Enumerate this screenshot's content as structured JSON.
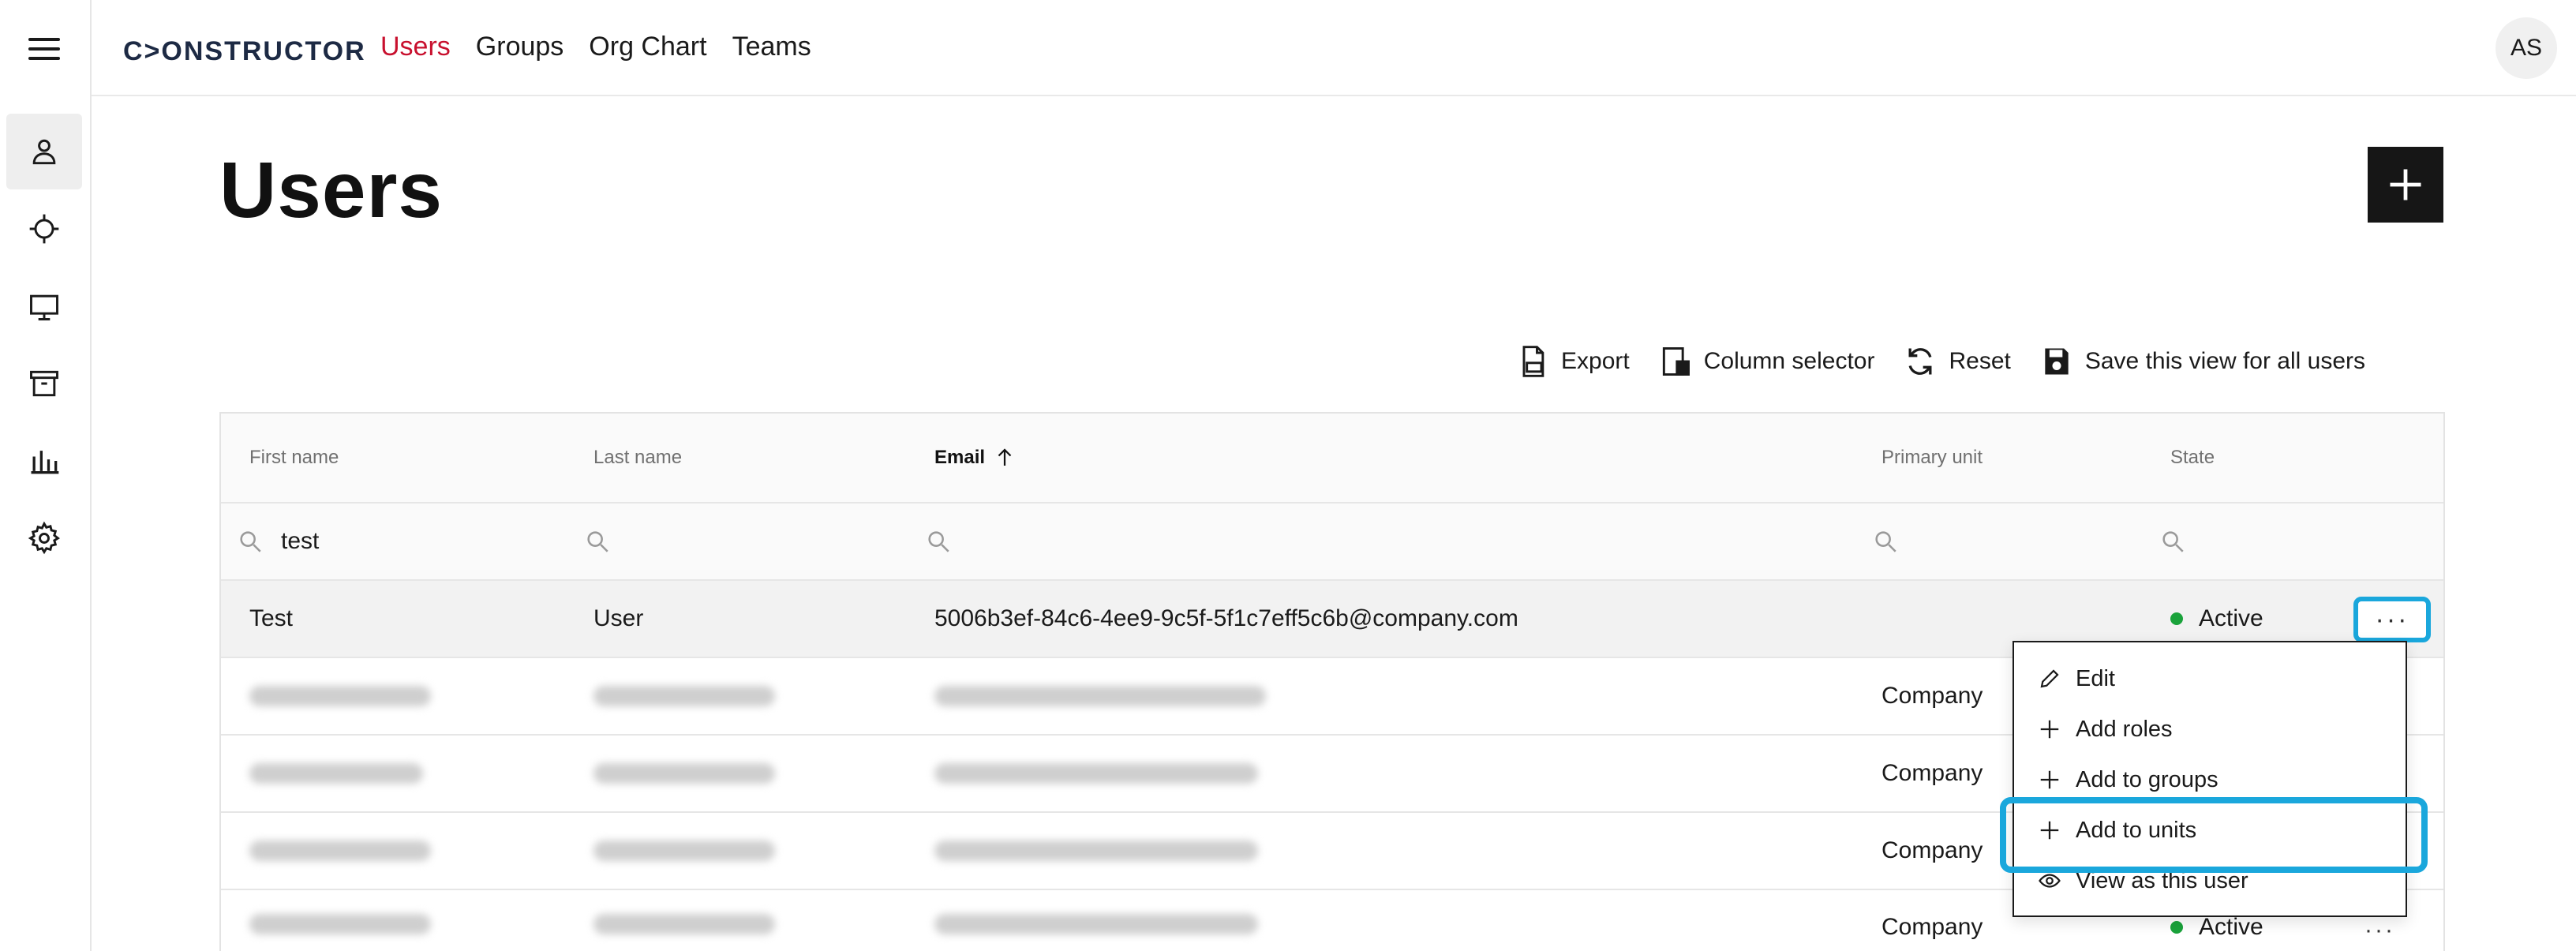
{
  "app": {
    "logo_text": "C>ONSTRUCTOR",
    "avatar_initials": "AS"
  },
  "nav": [
    {
      "label": "Users",
      "active": true
    },
    {
      "label": "Groups",
      "active": false
    },
    {
      "label": "Org Chart",
      "active": false
    },
    {
      "label": "Teams",
      "active": false
    }
  ],
  "sidebar": {
    "items": [
      {
        "icon": "user-icon",
        "active": true
      },
      {
        "icon": "crosshair-icon",
        "active": false
      },
      {
        "icon": "monitor-icon",
        "active": false
      },
      {
        "icon": "archive-icon",
        "active": false
      },
      {
        "icon": "bar-chart-icon",
        "active": false
      },
      {
        "icon": "gear-icon",
        "active": false
      }
    ]
  },
  "page": {
    "title": "Users"
  },
  "toolbar": {
    "export_label": "Export",
    "column_selector_label": "Column selector",
    "reset_label": "Reset",
    "save_view_label": "Save this view for all users"
  },
  "table": {
    "columns": [
      "First name",
      "Last name",
      "Email",
      "Primary unit",
      "State"
    ],
    "sorted_column": "Email",
    "filters": {
      "first_name": "test"
    },
    "rows": [
      {
        "first": "Test",
        "last": "User",
        "email": "5006b3ef-84c6-4ee9-9c5f-5f1c7eff5c6b@company.com",
        "unit": "",
        "state": "Active"
      },
      {
        "first": "",
        "last": "",
        "email": "",
        "unit": "Company",
        "state": ""
      },
      {
        "first": "",
        "last": "",
        "email": "",
        "unit": "Company",
        "state": ""
      },
      {
        "first": "",
        "last": "",
        "email": "",
        "unit": "Company",
        "state": ""
      },
      {
        "first": "",
        "last": "",
        "email": "",
        "unit": "Company",
        "state": "Active"
      }
    ],
    "more_label": "···"
  },
  "row_menu": {
    "items": [
      "Edit",
      "Add roles",
      "Add to groups",
      "Add to units",
      "View as this user"
    ],
    "highlighted": "Add to units"
  },
  "colors": {
    "accent_red": "#c8102e",
    "highlight_blue": "#1aa7dc",
    "active_green": "#1aa33b"
  }
}
